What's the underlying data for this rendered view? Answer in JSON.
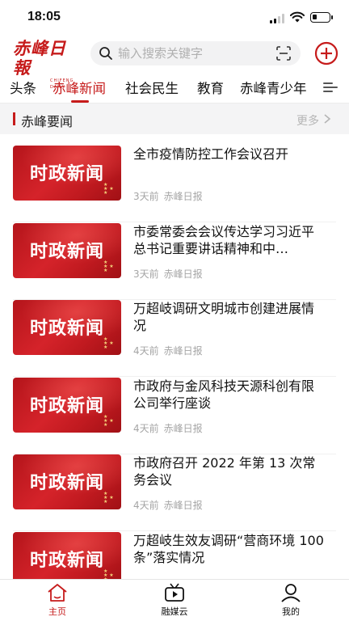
{
  "status_bar": {
    "time": "18:05",
    "battery_level": 0.3
  },
  "header": {
    "logo_text": "赤峰日報",
    "logo_subtext": "CHIFENG DAILY",
    "search_placeholder": "输入搜索关键字",
    "add_icon": "plus-circle-icon",
    "scan_icon": "scan-icon"
  },
  "colors": {
    "brand": "#c61b1b",
    "muted": "#a5a5a5",
    "section_bg": "#f4f4f5"
  },
  "tabs": [
    {
      "label": "头条",
      "active": false
    },
    {
      "label": "赤峰新闻",
      "active": true
    },
    {
      "label": "社会民生",
      "active": false
    },
    {
      "label": "教育",
      "active": false
    },
    {
      "label": "赤峰青少年",
      "active": false
    }
  ],
  "section": {
    "title": "赤峰要闻",
    "more_label": "更多"
  },
  "news": [
    {
      "title": "全市疫情防控工作会议召开",
      "time": "3天前",
      "source": "赤峰日报",
      "thumb_text": "时政新闻"
    },
    {
      "title": "市委常委会会议传达学习习近平总书记重要讲话精神和中…",
      "time": "3天前",
      "source": "赤峰日报",
      "thumb_text": "时政新闻"
    },
    {
      "title": "万超岐调研文明城市创建进展情况",
      "time": "4天前",
      "source": "赤峰日报",
      "thumb_text": "时政新闻"
    },
    {
      "title": "市政府与金风科技天源科创有限公司举行座谈",
      "time": "4天前",
      "source": "赤峰日报",
      "thumb_text": "时政新闻"
    },
    {
      "title": "市政府召开 2022 年第 13 次常务会议",
      "time": "4天前",
      "source": "赤峰日报",
      "thumb_text": "时政新闻"
    },
    {
      "title": "万超岐生效友调研“营商环境 100条”落实情况",
      "time": "",
      "source": "",
      "thumb_text": "时政新闻"
    }
  ],
  "bottom_nav": [
    {
      "label": "主页",
      "icon": "home-icon",
      "active": true
    },
    {
      "label": "融媒云",
      "icon": "video-icon",
      "active": false
    },
    {
      "label": "我的",
      "icon": "profile-icon",
      "active": false
    }
  ]
}
